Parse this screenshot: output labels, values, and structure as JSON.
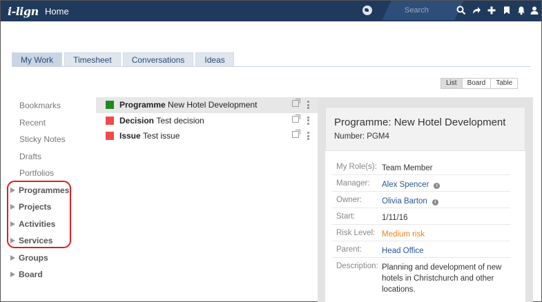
{
  "app": {
    "logo": "i-lign",
    "page_title": "Home"
  },
  "topbar": {
    "search_placeholder": "Search",
    "icons": [
      "globe-icon",
      "search-icon",
      "share-icon",
      "add-icon",
      "bookmark-icon",
      "bell-icon",
      "user-icon"
    ]
  },
  "tabs": [
    {
      "label": "My Work",
      "active": true
    },
    {
      "label": "Timesheet",
      "active": false
    },
    {
      "label": "Conversations",
      "active": false
    },
    {
      "label": "Ideas",
      "active": false
    }
  ],
  "view_toggle": [
    {
      "label": "List",
      "active": true
    },
    {
      "label": "Board",
      "active": false
    },
    {
      "label": "Table",
      "active": false
    }
  ],
  "nav": {
    "items": [
      "Bookmarks",
      "Recent",
      "Sticky Notes",
      "Drafts",
      "Portfolios"
    ],
    "groups": [
      "Programmes",
      "Projects",
      "Activities",
      "Services",
      "Groups",
      "Board"
    ]
  },
  "work_items": [
    {
      "type": "Programme",
      "name": "New Hotel Development",
      "color": "#1e8a1e",
      "selected": true
    },
    {
      "type": "Decision",
      "name": "Test decision",
      "color": "#f04a4a",
      "selected": false
    },
    {
      "type": "Issue",
      "name": "Test issue",
      "color": "#f04a4a",
      "selected": false
    }
  ],
  "detail": {
    "title": "Programme: New Hotel Development",
    "number": "Number: PGM4",
    "props": [
      {
        "key": "My Role(s):",
        "value": "Team Member"
      },
      {
        "key": "Manager:",
        "value": "Alex Spencer"
      },
      {
        "key": "Owner:",
        "value": "Olivia Barton"
      },
      {
        "key": "Start:",
        "value": "1/11/16"
      },
      {
        "key": "Risk Level:",
        "value": "Medium risk",
        "color": "#e8851a"
      },
      {
        "key": "Parent:",
        "value": "Head Office"
      },
      {
        "key": "Description:",
        "value": "Planning and development of new hotels in Christchurch and other locations."
      }
    ]
  },
  "colors": {
    "topbar": "#1f3a5c",
    "link": "#2a5599",
    "highlight": "#e01b1b"
  }
}
